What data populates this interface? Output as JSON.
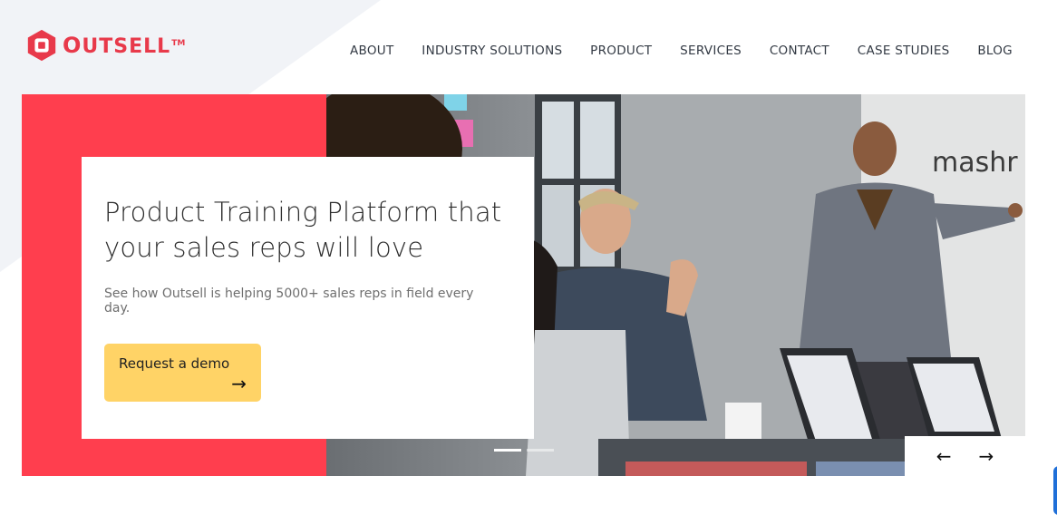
{
  "brand": {
    "name_first": "O",
    "name_rest": "UTSELL",
    "trademark": "TM",
    "accent_color": "#e8394a"
  },
  "nav": {
    "items": [
      "ABOUT",
      "INDUSTRY SOLUTIONS",
      "PRODUCT",
      "SERVICES",
      "CONTACT",
      "CASE STUDIES",
      "BLOG"
    ]
  },
  "hero": {
    "headline": "Product Training Platform that your sales reps will love",
    "subtext": "See how Outsell is helping 5000+ sales reps in field every day.",
    "cta_label": "Request a demo",
    "cta_arrow": "→",
    "cta_color": "#ffd366",
    "panel_color": "#ff3e4e",
    "photo_wall_text": "mashr",
    "slides_total": 2,
    "active_slide": 1,
    "prev_arrow": "←",
    "next_arrow": "→"
  }
}
